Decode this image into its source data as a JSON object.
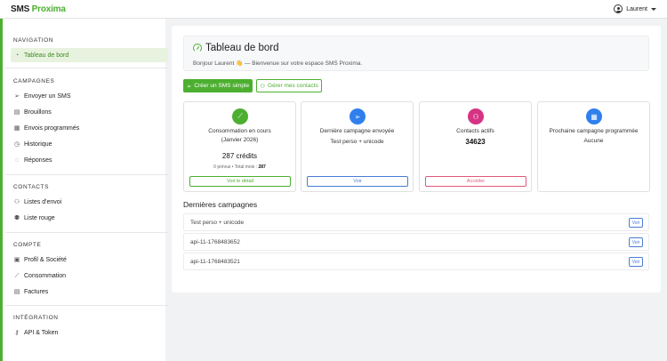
{
  "app": {
    "logo_left": "SMS",
    "logo_right": "Proxima"
  },
  "user": {
    "name": "Laurent"
  },
  "sidebar": {
    "sections": [
      {
        "title": "NAVIGATION",
        "items": [
          {
            "label": "Tableau de bord",
            "icon": "gauge-icon",
            "active": true
          }
        ]
      },
      {
        "title": "CAMPAGNES",
        "items": [
          {
            "label": "Envoyer un SMS",
            "icon": "send-icon"
          },
          {
            "label": "Brouillons",
            "icon": "document-icon"
          },
          {
            "label": "Envois programmés",
            "icon": "calendar-icon"
          },
          {
            "label": "Historique",
            "icon": "clock-icon"
          },
          {
            "label": "Réponses",
            "icon": "chat-icon"
          }
        ]
      },
      {
        "title": "CONTACTS",
        "items": [
          {
            "label": "Listes d'envoi",
            "icon": "people-icon"
          },
          {
            "label": "Liste rouge",
            "icon": "person-block-icon"
          }
        ]
      },
      {
        "title": "COMPTE",
        "items": [
          {
            "label": "Profil & Société",
            "icon": "id-card-icon"
          },
          {
            "label": "Consommation",
            "icon": "chart-icon"
          },
          {
            "label": "Factures",
            "icon": "invoice-icon"
          }
        ]
      },
      {
        "title": "INTÉGRATION",
        "items": [
          {
            "label": "API & Token",
            "icon": "key-icon"
          }
        ]
      }
    ]
  },
  "header": {
    "title": "Tableau de bord",
    "subtitle": "Bonjour Laurent 👋 — Bienvenue sur votre espace SMS Proxima."
  },
  "actions": {
    "primary": "Créer un SMS simple",
    "secondary": "Gérer mes contacts"
  },
  "cards": {
    "consumption": {
      "title_line1": "Consommation en cours",
      "title_line2": "(Janvier 2026)",
      "value": "287 crédits",
      "detail_prefix": "0 prévus • Total mois :",
      "detail_total": "287",
      "button": "Voir le détail",
      "color": "#4caf30"
    },
    "last_campaign": {
      "title": "Dernière campagne envoyée",
      "name": "Test perso + unicode",
      "button": "Voir",
      "color": "#2f80ed"
    },
    "contacts": {
      "title": "Contacts actifs",
      "value": "34623",
      "button": "Accéder",
      "color": "#d63384"
    },
    "next_campaign": {
      "title": "Prochaine campagne programmée",
      "value": "Aucune",
      "color": "#2f80ed"
    }
  },
  "recent": {
    "title": "Dernières campagnes",
    "rows": [
      {
        "name": "Test perso + unicode",
        "action": "Voir"
      },
      {
        "name": "api-11-1768483652",
        "action": "Voir"
      },
      {
        "name": "api-11-1768483521",
        "action": "Voir"
      }
    ]
  }
}
